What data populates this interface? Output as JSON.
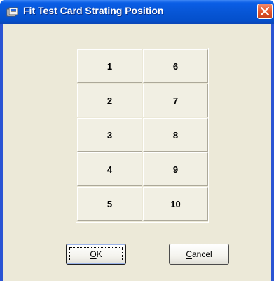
{
  "window": {
    "title": "Fit Test Card Strating Position",
    "title_icon": "card-stack-icon",
    "close_icon": "close-icon"
  },
  "positions": {
    "left_column": [
      "1",
      "2",
      "3",
      "4",
      "5"
    ],
    "right_column": [
      "6",
      "7",
      "8",
      "9",
      "10"
    ]
  },
  "buttons": {
    "ok": {
      "mnemonic": "O",
      "rest": "K"
    },
    "cancel": {
      "mnemonic": "C",
      "rest": "ancel"
    }
  },
  "colors": {
    "titlebar": "#0756d6",
    "dialog_face": "#ece9d8",
    "close_button": "#e2552c"
  }
}
